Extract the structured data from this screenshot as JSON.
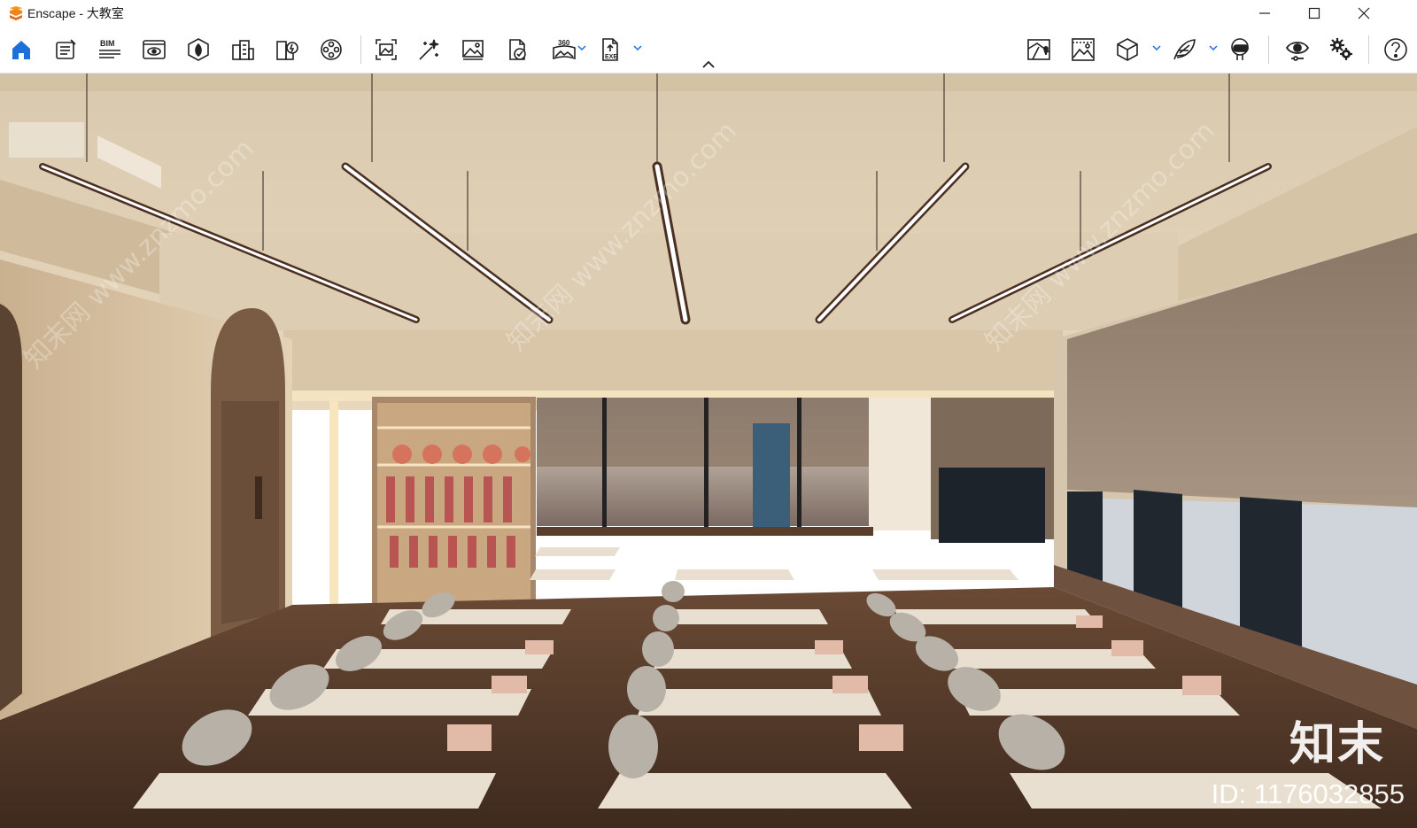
{
  "window": {
    "title": "Enscape - 大教室",
    "controls": [
      "minimize-icon",
      "maximize-icon",
      "close-icon"
    ]
  },
  "toolbar": {
    "left_icons": [
      "home-icon",
      "project-notes-icon",
      "bim-icon",
      "views-icon",
      "asset-library-icon",
      "site-context-icon",
      "material-editor-icon",
      "video-editor-icon"
    ],
    "middle_icons": [
      "screenshot-icon",
      "magic-wand-icon",
      "image-export-icon",
      "web-standalone-icon",
      "panorama-360-icon",
      "exe-export-icon"
    ],
    "bim_label": "BIM",
    "pano_label": "360",
    "exe_label": "EXE",
    "right_icons": [
      "map-icon",
      "image-rendering-icon",
      "cube-view-icon",
      "feather-icon",
      "vr-headset-icon",
      "visual-settings-icon",
      "general-settings-icon",
      "help-icon"
    ],
    "accent": "#1e6fd9"
  },
  "viewport": {
    "watermark_brand": "知末",
    "watermark_id": "ID: 1176032855",
    "watermark_text": "知末网 www.znzmo.com"
  }
}
